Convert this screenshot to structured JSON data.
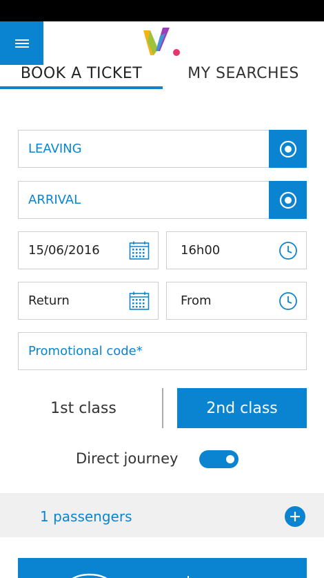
{
  "tabs": {
    "book": "BOOK A TICKET",
    "searches": "MY SEARCHES"
  },
  "form": {
    "leaving": "LEAVING",
    "arrival": "ARRIVAL",
    "date": "15/06/2016",
    "time": "16h00",
    "return": "Return",
    "from": "From",
    "promo": "Promotional code*"
  },
  "classes": {
    "first": "1st class",
    "second": "2nd class",
    "selected": "2nd class"
  },
  "direct": {
    "label": "Direct journey",
    "on": true
  },
  "passengers": {
    "label": "1 passengers"
  },
  "colors": {
    "accent": "#0a84d0"
  }
}
